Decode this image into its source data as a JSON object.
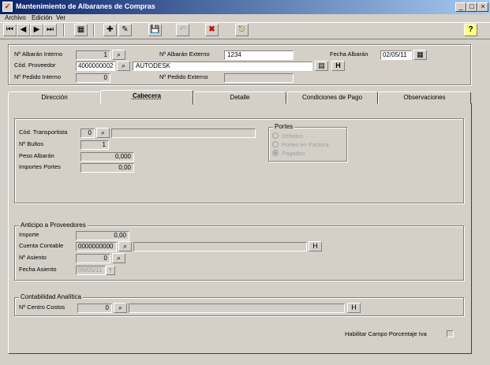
{
  "window": {
    "title": "Mantenimiento de Albaranes de Compras",
    "app_icon": "app-icon",
    "min": "_",
    "max": "□",
    "close": "×"
  },
  "menu": [
    "Archivo",
    "Edición",
    "Ver"
  ],
  "toolbar": {
    "first": "⏮",
    "prev": "◀",
    "next": "▶",
    "last": "⏭",
    "calc": "▦",
    "new": "✚",
    "edit": "✎",
    "save": "💾",
    "undo": "↶",
    "delete": "✖",
    "exit": "⎋",
    "help": "?"
  },
  "header": {
    "albaran_interno_label": "Nº Albarán Interno",
    "albaran_interno_value": "1",
    "albaran_externo_label": "Nº Albarán Externo",
    "albaran_externo_value": "1234",
    "fecha_albaran_label": "Fecha Albarán",
    "fecha_albaran_value": "02/05/11",
    "proveedor_label": "Cód. Proveedor",
    "proveedor_code": "4000000002",
    "proveedor_name": "AUTODESK",
    "pedido_interno_label": "Nº Pedido Interno",
    "pedido_interno_value": "0",
    "pedido_externo_label": "Nº Pedido Externo",
    "pedido_externo_value": "",
    "h_button": "H"
  },
  "tabs": [
    "Dirección",
    "Cabecera",
    "Detalle",
    "Condiciones de Pago",
    "Observaciones"
  ],
  "cabecera": {
    "transportista_label": "Cód. Transportista",
    "transportista_value": "0",
    "transportista_name": "",
    "bultos_label": "Nº Bultos",
    "bultos_value": "1",
    "peso_label": "Peso Albarán",
    "peso_value": "0,000",
    "portes_importe_label": "Importes Portes",
    "portes_importe_value": "0,00",
    "portes": {
      "title": "Portes",
      "options": [
        "Debidos",
        "Portes en Factura",
        "Pagados"
      ],
      "selected": "Pagados"
    }
  },
  "anticipo": {
    "title": "Anticipo a Proveedores",
    "importe_label": "Importe",
    "importe_value": "0,00",
    "cuenta_label": "Cuenta Contable",
    "cuenta_value": "0000000000",
    "cuenta_name": "",
    "asiento_label": "Nº Asiento",
    "asiento_value": "0",
    "fecha_label": "Fecha Asiento",
    "fecha_value": "06/05/11",
    "h_button": "H"
  },
  "analitica": {
    "title": "Contabilidad Analítica",
    "centro_label": "Nº Centro Costos",
    "centro_value": "0",
    "centro_name": "",
    "h_button": "H"
  },
  "footer": {
    "iva_label": "Habilitar Campo Porcentaje Iva",
    "iva_checked": false
  }
}
